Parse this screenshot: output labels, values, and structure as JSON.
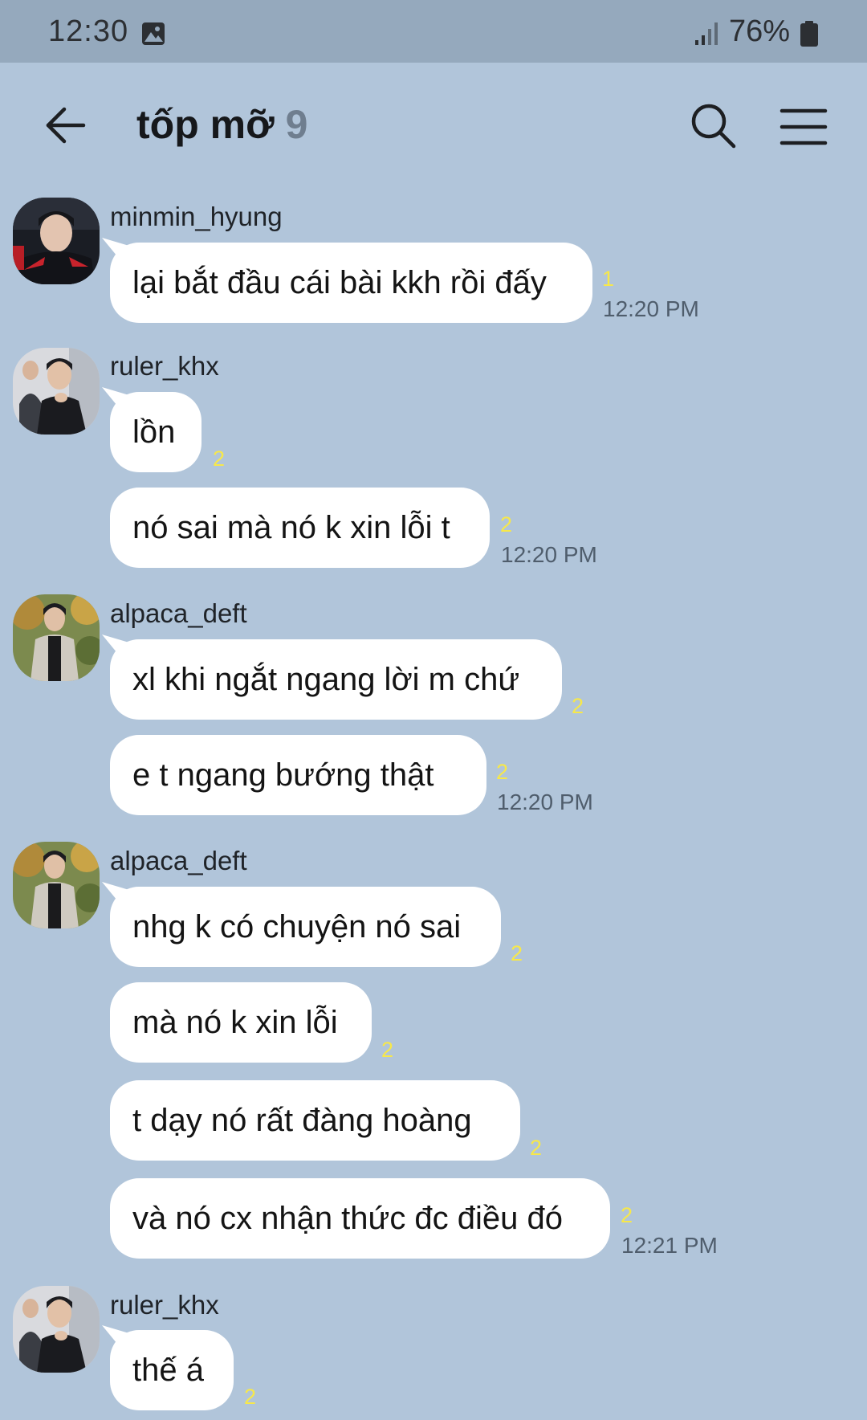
{
  "status_bar": {
    "time": "12:30",
    "battery": "76%"
  },
  "header": {
    "title": "tốp mỡ",
    "member_count": "9"
  },
  "messages": [
    {
      "sender": "minmin_hyung",
      "bubbles": [
        {
          "text": "lại bắt đầu cái bài kkh rồi đấy",
          "unread": "1",
          "time": "12:20 PM"
        }
      ]
    },
    {
      "sender": "ruler_khx",
      "bubbles": [
        {
          "text": "lồn",
          "unread": "2"
        },
        {
          "text": "nó sai mà nó k xin lỗi t",
          "unread": "2",
          "time": "12:20 PM"
        }
      ]
    },
    {
      "sender": "alpaca_deft",
      "bubbles": [
        {
          "text": "xl khi ngắt ngang lời m chứ",
          "unread": "2"
        },
        {
          "text": "e t ngang bướng thật",
          "unread": "2",
          "time": "12:20 PM"
        }
      ]
    },
    {
      "sender": "alpaca_deft",
      "bubbles": [
        {
          "text": "nhg k có chuyện nó sai",
          "unread": "2"
        },
        {
          "text": "mà nó k xin lỗi",
          "unread": "2"
        },
        {
          "text": "t dạy nó rất đàng hoàng",
          "unread": "2"
        },
        {
          "text": "và nó cx nhận thức đc điều đó",
          "unread": "2",
          "time": "12:21 PM"
        }
      ]
    },
    {
      "sender": "ruler_khx",
      "bubbles": [
        {
          "text": "thế á",
          "unread": "2"
        }
      ]
    }
  ],
  "icons": {
    "back": "arrow-left-icon",
    "search": "search-icon",
    "menu": "hamburger-menu-icon",
    "gallery": "image-icon",
    "signal": "signal-icon",
    "battery": "battery-icon"
  },
  "colors": {
    "chat_background": "#b1c5da",
    "status_bar_background": "#95a9bd",
    "bubble": "#ffffff",
    "unread_count": "#f7e84a"
  }
}
